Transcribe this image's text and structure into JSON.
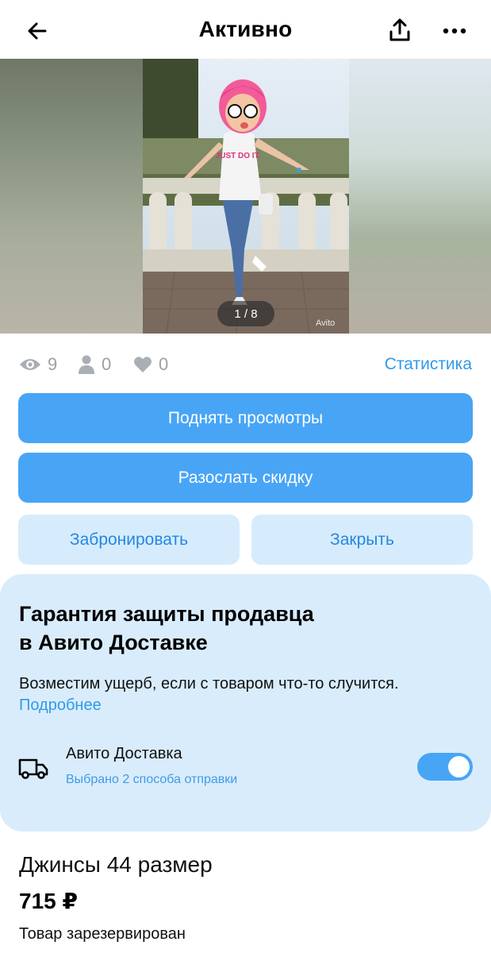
{
  "header": {
    "title": "Активно",
    "back_icon": "back-arrow-icon",
    "share_icon": "share-icon",
    "more_icon": "more-icon"
  },
  "gallery": {
    "counter": "1 / 8",
    "watermark": "Avito",
    "shirt_text": "JUST DO IT."
  },
  "stats": {
    "views": "9",
    "contacts": "0",
    "favorites": "0",
    "link": "Статистика",
    "accent_color": "#2f9ae8"
  },
  "actions": {
    "raise_views": "Поднять просмотры",
    "send_discount": "Разослать скидку",
    "reserve": "Забронировать",
    "close": "Закрыть",
    "primary_color": "#48a5f6",
    "secondary_color": "#d6ecfd"
  },
  "guarantee": {
    "title_line1": "Гарантия защиты продавца",
    "title_line2": "в Авито Доставке",
    "description": "Возместим ущерб, если с товаром что-то случится.",
    "more_link": "Подробнее",
    "delivery_title": "Авито Доставка",
    "delivery_subtitle": "Выбрано 2 способа отправки",
    "toggle_on": true,
    "background_color": "#d9ecfc"
  },
  "item": {
    "title": "Джинсы 44 размер",
    "price": "715 ₽",
    "status": "Товар зарезервирован"
  }
}
